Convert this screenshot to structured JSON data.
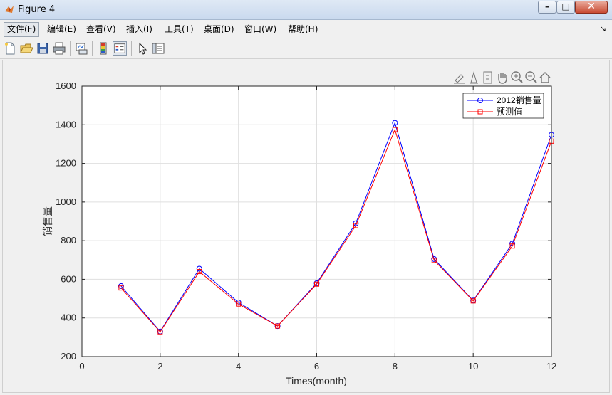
{
  "window": {
    "title": "Figure 4"
  },
  "menu": [
    "文件(F)",
    "编辑(E)",
    "查看(V)",
    "插入(I)",
    "工具(T)",
    "桌面(D)",
    "窗口(W)",
    "帮助(H)"
  ],
  "toolbar": [
    "new-figure-icon",
    "open-file-icon",
    "save-icon",
    "print-icon",
    "link-plot-icon",
    "colorbar-icon",
    "legend-icon",
    "pointer-icon",
    "property-inspector-icon"
  ],
  "axes_toolbar": [
    "brush-icon",
    "data-cursor-icon",
    "rotate-icon",
    "pan-icon",
    "zoom-in-icon",
    "zoom-out-icon",
    "home-icon"
  ],
  "chart_data": {
    "type": "line",
    "xlabel": "Times(month)",
    "ylabel": "销售量",
    "xlim": [
      0,
      12
    ],
    "ylim": [
      200,
      1600
    ],
    "xticks": [
      0,
      2,
      4,
      6,
      8,
      10,
      12
    ],
    "yticks": [
      200,
      400,
      600,
      800,
      1000,
      1200,
      1400,
      1600
    ],
    "grid": true,
    "legend_position": "top-right",
    "x": [
      1,
      2,
      3,
      4,
      5,
      6,
      7,
      8,
      9,
      10,
      11,
      12
    ],
    "series": [
      {
        "name": "2012销售量",
        "color": "#0000ff",
        "marker": "circle",
        "values": [
          565,
          330,
          655,
          480,
          358,
          580,
          890,
          1410,
          705,
          490,
          785,
          1348
        ]
      },
      {
        "name": "预测值",
        "color": "#ff0000",
        "marker": "square",
        "values": [
          555,
          328,
          640,
          472,
          358,
          575,
          878,
          1375,
          698,
          488,
          772,
          1315
        ]
      }
    ]
  }
}
